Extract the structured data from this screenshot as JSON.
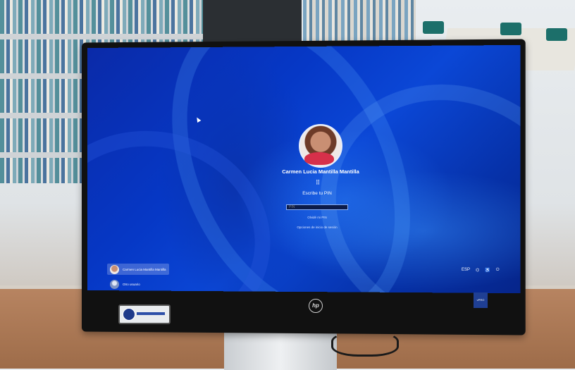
{
  "lock_screen": {
    "user_name": "Carmen Lucia Mantilla Mantilla",
    "keypad_icon": "keypad-icon",
    "pin_title": "Escribe tu PIN",
    "pin_placeholder": "PIN",
    "forgot_pin": "Olvidé mi PIN",
    "sign_in_options": "Opciones de inicio de sesión"
  },
  "user_list": [
    {
      "label": "Carmen Lucia Mantilla Mantilla",
      "selected": true
    },
    {
      "label": "Otro usuario",
      "selected": false
    }
  ],
  "tray_icons": [
    "language-icon",
    "network-icon",
    "accessibility-icon",
    "power-icon"
  ],
  "tray": {
    "language": "ESP"
  },
  "monitor": {
    "brand": "hp",
    "badge": "vPRO"
  },
  "colors": {
    "wallpaper": "#0638c6",
    "text": "#ffffff"
  }
}
